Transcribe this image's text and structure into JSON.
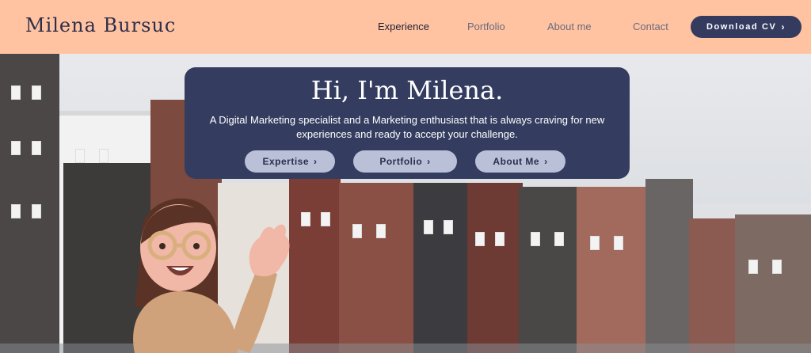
{
  "header": {
    "brand": "Milena Bursuc",
    "nav": [
      "Experience",
      "Portfolio",
      "About me",
      "Contact"
    ],
    "active_nav": "Experience",
    "cta_label": "Download CV",
    "cta_icon": "chevron-right-icon"
  },
  "hero": {
    "title": "Hi, I'm Milena.",
    "subtitle": "A Digital Marketing specialist and a Marketing enthusiast that is always craving for new experiences and ready to accept your challenge.",
    "buttons": [
      "Expertise",
      "Portfolio",
      "About Me"
    ]
  },
  "colors": {
    "header_bg": "#ffc3a1",
    "card_bg": "#343d60",
    "button_bg": "#343b5f",
    "pill_bg": "#b9c0d8"
  }
}
